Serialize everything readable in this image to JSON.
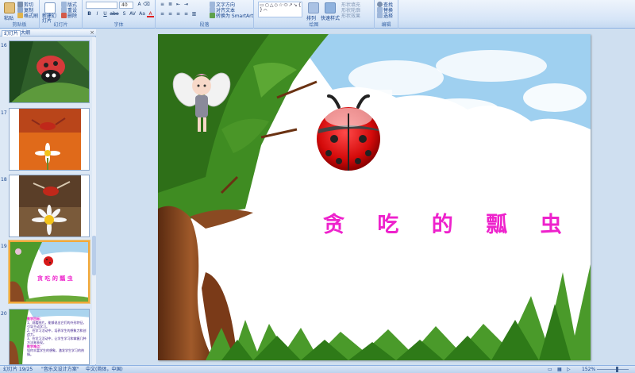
{
  "ribbon": {
    "clipboard": {
      "label": "剪贴板",
      "paste": "粘贴",
      "cut": "剪切",
      "copy": "复制",
      "format_painter": "格式刷"
    },
    "slides": {
      "label": "幻灯片",
      "new_slide": "新建幻灯片",
      "layout": "版式",
      "reset": "重设",
      "delete": "删除"
    },
    "font": {
      "label": "字体",
      "font_size": "40",
      "bold": "B",
      "italic": "I",
      "underline": "U",
      "strike": "abe",
      "shadow": "S",
      "spacing": "AV",
      "case": "Aa",
      "color": "A"
    },
    "paragraph": {
      "label": "段落",
      "text_direction": "文字方向",
      "align_text": "对齐文本",
      "smartart": "转换为 SmartArt"
    },
    "drawing": {
      "label": "绘图",
      "arrange": "排列",
      "quick_styles": "快速样式",
      "shape_fill": "形状填充",
      "shape_outline": "形状轮廓",
      "shape_effects": "形状效果"
    },
    "editing": {
      "label": "编辑",
      "find": "查找",
      "replace": "替换",
      "select": "选择"
    }
  },
  "pane": {
    "tab_slides": "幻灯片",
    "tab_outline": "大纲",
    "close": "×",
    "thumbnails": [
      {
        "num": "16"
      },
      {
        "num": "17"
      },
      {
        "num": "18"
      },
      {
        "num": "19",
        "title": "贪 吃 的 瓢 虫"
      },
      {
        "num": "20",
        "heading": "教学目标：",
        "line1": "1、观看图片，能够说出它们的外形特征，引导主动学习。",
        "line2": "2、在学习活动中，培养学生的想象力和创造力。",
        "line3": "3、在学习活动中，让学生学习和掌握几种方法来表现。",
        "heading2": "教学难点：",
        "line4": "如何丰富学生的想象，激发学生学习的热情。"
      }
    ]
  },
  "slide": {
    "title": "贪 吃 的 瓢 虫"
  },
  "status": {
    "slide_pos": "幻灯片 19/25",
    "theme": "\"音乐文设计方案\"",
    "language": "中文(简体，中国)",
    "zoom": "152%"
  },
  "colors": {
    "title": "#ee22cc",
    "ribbon_bg": "#d6e5f7",
    "selection": "#f2a93b"
  }
}
